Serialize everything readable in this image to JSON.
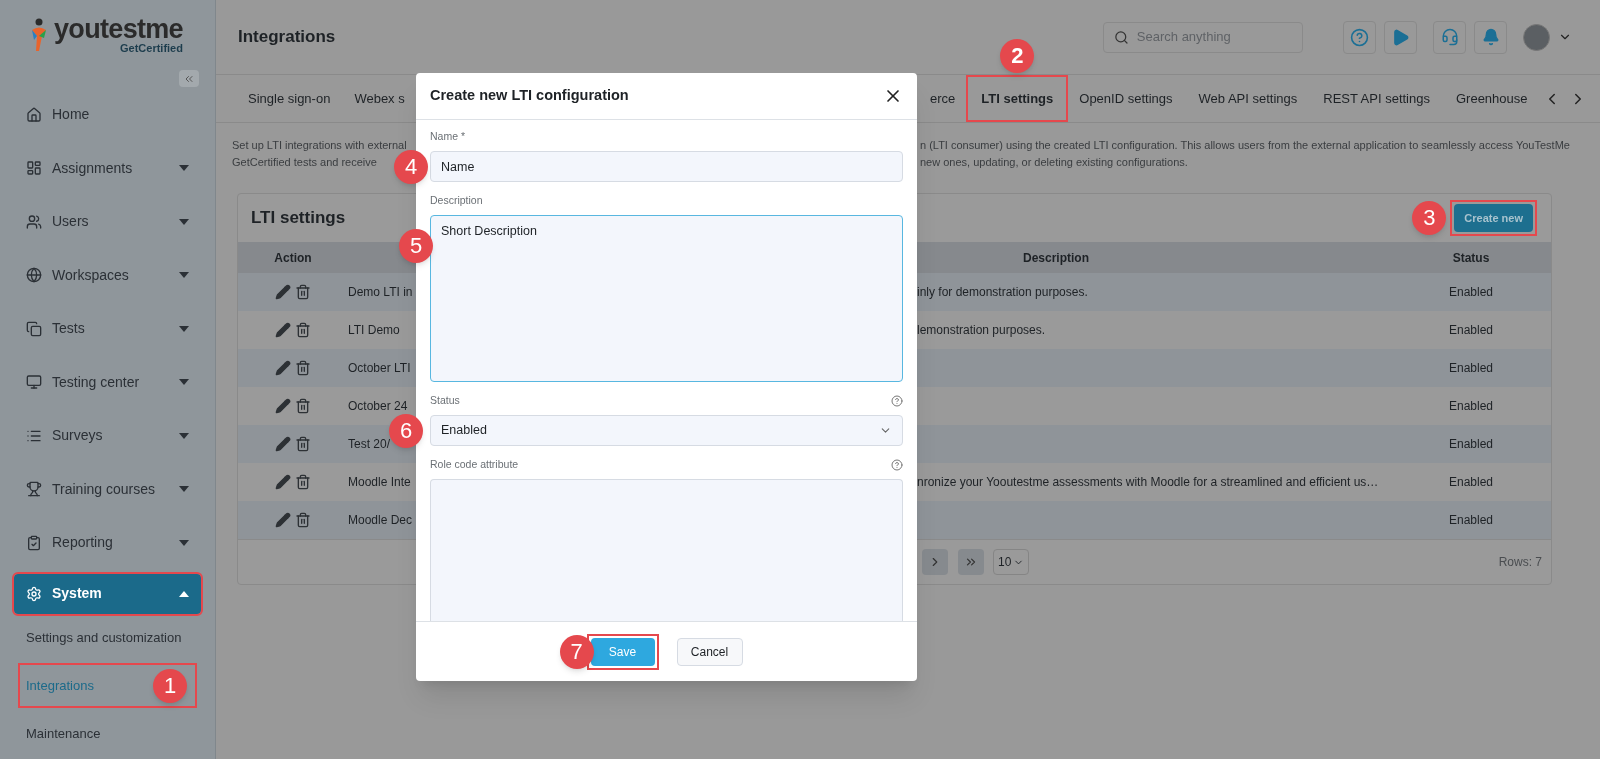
{
  "sidebar": {
    "logo": {
      "wordmark": "youtestme",
      "tagline": "GetCertified"
    },
    "items": [
      {
        "kind": "link",
        "label": "Home",
        "selected": false,
        "highlighted": false
      },
      {
        "kind": "group",
        "label": "Assignments",
        "expanded": false,
        "selected": false,
        "highlighted": false
      },
      {
        "kind": "group",
        "label": "Users",
        "expanded": false,
        "selected": false,
        "highlighted": false
      },
      {
        "kind": "group",
        "label": "Workspaces",
        "expanded": false,
        "selected": false,
        "highlighted": false
      },
      {
        "kind": "group",
        "label": "Tests",
        "expanded": false,
        "selected": false,
        "highlighted": false
      },
      {
        "kind": "group",
        "label": "Testing center",
        "expanded": false,
        "selected": false,
        "highlighted": false
      },
      {
        "kind": "group",
        "label": "Surveys",
        "expanded": false,
        "selected": false,
        "highlighted": false
      },
      {
        "kind": "group",
        "label": "Training courses",
        "expanded": false,
        "selected": false,
        "highlighted": false
      },
      {
        "kind": "group",
        "label": "Reporting",
        "expanded": false,
        "selected": false,
        "highlighted": false
      },
      {
        "kind": "group",
        "label": "System",
        "expanded": true,
        "selected": true,
        "highlighted": true,
        "children": [
          {
            "label": "Settings and customization",
            "selected": false,
            "highlighted": false
          },
          {
            "label": "Integrations",
            "selected": true,
            "highlighted": true,
            "marker": "1"
          },
          {
            "label": "Maintenance",
            "selected": false,
            "highlighted": false
          }
        ]
      }
    ]
  },
  "header": {
    "title": "Integrations",
    "search": {
      "placeholder": "Search anything"
    }
  },
  "tabs_left": [
    {
      "label": "Single sign-on",
      "selected": false,
      "highlighted": false
    },
    {
      "label": "Webex s",
      "selected": false,
      "highlighted": false
    }
  ],
  "tabs_right": [
    {
      "label": "erce",
      "selected": false,
      "highlighted": false
    },
    {
      "label": "LTI settings",
      "selected": true,
      "highlighted": true,
      "marker": "2"
    },
    {
      "label": "OpenID settings",
      "selected": false,
      "highlighted": false
    },
    {
      "label": "Web API settings",
      "selected": false,
      "highlighted": false
    },
    {
      "label": "REST API settings",
      "selected": false,
      "highlighted": false
    },
    {
      "label": "Greenhouse",
      "selected": false,
      "highlighted": false
    }
  ],
  "intro": {
    "left_lines": [
      "Set up LTI integrations with external",
      "GetCertified tests and receive"
    ],
    "right_lines": [
      "n (LTI consumer) using the created LTI configuration. This allows users from the external application to seamlessly access YouTestMe",
      "new ones, updating, or deleting existing configurations."
    ]
  },
  "card": {
    "title": "LTI settings",
    "create_button": {
      "label": "Create new",
      "highlighted": true,
      "marker": "3"
    },
    "columns": {
      "action": "Action",
      "description": "Description",
      "status": "Status"
    },
    "rows": [
      {
        "name": "Demo LTI in",
        "description": "inly for demonstration purposes.",
        "status": "Enabled"
      },
      {
        "name": "LTI Demo",
        "description": "lemonstration purposes.",
        "status": "Enabled"
      },
      {
        "name": "October LTI",
        "status": "Enabled"
      },
      {
        "name": "October 24",
        "status": "Enabled"
      },
      {
        "name": "Test 20/",
        "status": "Enabled"
      },
      {
        "name": "Moodle Inte",
        "description": "nronize your Yooutestme assessments with Moodle for a streamlined and efficient us…",
        "status": "Enabled"
      },
      {
        "name": "Moodle Dec",
        "status": "Enabled"
      }
    ],
    "page_size": "10",
    "rows_label": "Rows: 7"
  },
  "dialog": {
    "title": "Create new LTI configuration",
    "fields": [
      {
        "kind": "text",
        "label": "Name *",
        "value": "Name",
        "help": false,
        "focused": false,
        "marker": "4"
      },
      {
        "kind": "textarea",
        "label": "Description",
        "value": "Short Description",
        "help": false,
        "focused": true,
        "marker": "5"
      },
      {
        "kind": "select",
        "label": "Status",
        "value": "Enabled",
        "help": true,
        "focused": false,
        "marker": "6"
      },
      {
        "kind": "textarea",
        "label": "Role code attribute",
        "help": true,
        "focused": false
      }
    ],
    "buttons": [
      {
        "kind": "primary",
        "label": "Save",
        "highlighted": true,
        "marker": "7"
      },
      {
        "kind": "secondary",
        "label": "Cancel",
        "highlighted": false
      }
    ]
  }
}
